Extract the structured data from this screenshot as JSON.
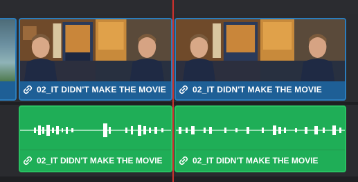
{
  "timeline": {
    "clips": [
      {
        "video_label": "02_IT DIDN'T MAKE THE MOVIE",
        "audio_label": "02_IT DIDN'T MAKE THE MOVIE"
      },
      {
        "video_label": "02_IT DIDN'T MAKE THE MOVIE",
        "audio_label": "02_IT DIDN'T MAKE THE MOVIE"
      }
    ]
  },
  "colors": {
    "video_clip": "#1e5f96",
    "audio_clip": "#1fae57",
    "playhead": "#d0312d",
    "track_background": "#2a2b2f"
  },
  "icons": {
    "clip_link": "link-icon"
  }
}
